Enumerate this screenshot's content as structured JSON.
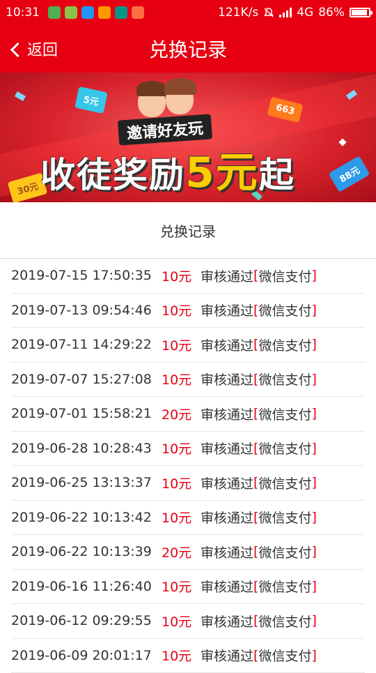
{
  "statusbar": {
    "time": "10:31",
    "speed": "121K/s",
    "network": "4G",
    "battery": "86%",
    "battery_level": 0.86,
    "app_icon_colors": [
      "#4caf50",
      "#8bc34a",
      "#2196f3",
      "#ff9800",
      "#009688",
      "#ff7043"
    ]
  },
  "navbar": {
    "back_label": "返回",
    "title": "兑换记录"
  },
  "banner": {
    "subtitle": "邀请好友玩",
    "main_text": "收徒奖励",
    "main_amount": "5元",
    "main_suffix": "起",
    "tags": [
      "5元",
      "663",
      "30元",
      "88元"
    ]
  },
  "section_title": "兑换记录",
  "records": [
    {
      "date": "2019-07-15 17:50:35",
      "amount": "10元",
      "status": "审核通过",
      "method": "微信支付"
    },
    {
      "date": "2019-07-13 09:54:46",
      "amount": "10元",
      "status": "审核通过",
      "method": "微信支付"
    },
    {
      "date": "2019-07-11 14:29:22",
      "amount": "10元",
      "status": "审核通过",
      "method": "微信支付"
    },
    {
      "date": "2019-07-07 15:27:08",
      "amount": "10元",
      "status": "审核通过",
      "method": "微信支付"
    },
    {
      "date": "2019-07-01 15:58:21",
      "amount": "20元",
      "status": "审核通过",
      "method": "微信支付"
    },
    {
      "date": "2019-06-28 10:28:43",
      "amount": "10元",
      "status": "审核通过",
      "method": "微信支付"
    },
    {
      "date": "2019-06-25 13:13:37",
      "amount": "10元",
      "status": "审核通过",
      "method": "微信支付"
    },
    {
      "date": "2019-06-22 10:13:42",
      "amount": "10元",
      "status": "审核通过",
      "method": "微信支付"
    },
    {
      "date": "2019-06-22 10:13:39",
      "amount": "20元",
      "status": "审核通过",
      "method": "微信支付"
    },
    {
      "date": "2019-06-16 11:26:40",
      "amount": "10元",
      "status": "审核通过",
      "method": "微信支付"
    },
    {
      "date": "2019-06-12 09:29:55",
      "amount": "10元",
      "status": "审核通过",
      "method": "微信支付"
    },
    {
      "date": "2019-06-09 20:01:17",
      "amount": "10元",
      "status": "审核通过",
      "method": "微信支付"
    }
  ],
  "colors": {
    "accent": "#e60012",
    "amount": "#e60012",
    "divider": "#e6e6e6"
  }
}
